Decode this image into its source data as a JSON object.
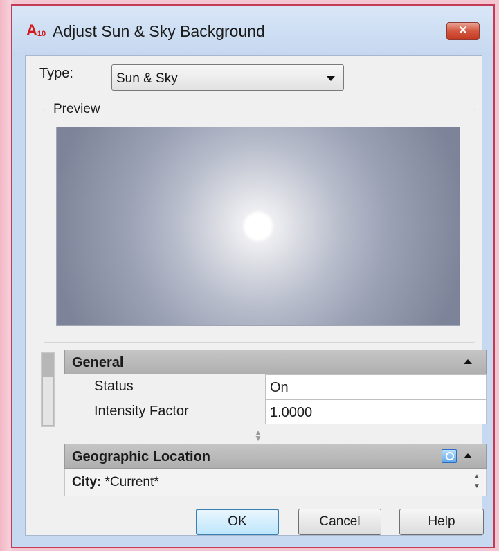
{
  "window": {
    "title": "Adjust Sun & Sky Background",
    "app_icon_letter": "A",
    "app_icon_version": "10",
    "close_glyph": "✕"
  },
  "type_field": {
    "label": "Type:",
    "selected": "Sun & Sky"
  },
  "preview": {
    "label": "Preview"
  },
  "sections": {
    "general": {
      "title": "General",
      "rows": [
        {
          "name": "Status",
          "value": "On"
        },
        {
          "name": "Intensity Factor",
          "value": "1.0000"
        }
      ]
    },
    "geographic_location": {
      "title": "Geographic Location",
      "city_label": "City:",
      "city_value": "*Current*"
    }
  },
  "buttons": {
    "ok": "OK",
    "cancel": "Cancel",
    "help": "Help"
  },
  "colors": {
    "window_border": "#c53a55",
    "close_button": "#c2391f",
    "default_button_border": "#3c7fb1"
  },
  "icons": {
    "close": "close-icon",
    "dropdown": "chevron-down-icon",
    "collapse": "collapse-up-icon",
    "locate": "geo-locate-icon",
    "spinner": "spinner-icon",
    "splitter": "splitter-grip-icon"
  }
}
